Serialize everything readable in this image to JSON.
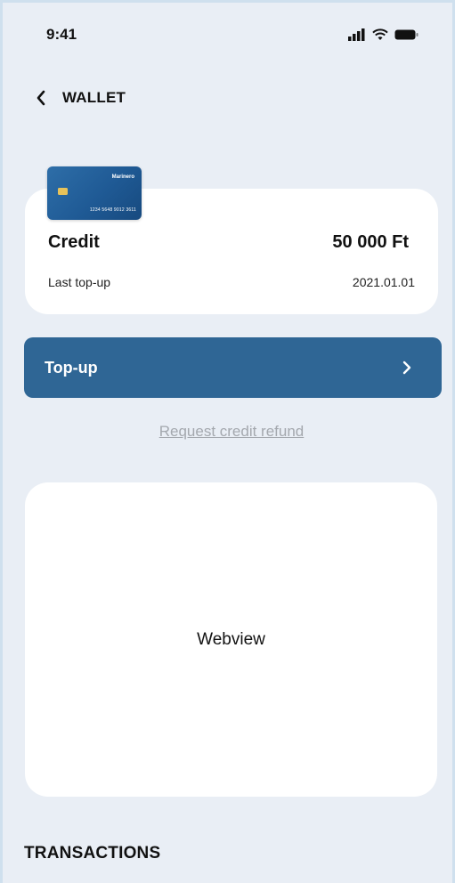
{
  "status_bar": {
    "time": "9:41"
  },
  "header": {
    "title": "WALLET"
  },
  "card": {
    "brand": "Marinero",
    "number": "1234 5648 9012 3611"
  },
  "credit": {
    "label": "Credit",
    "value": "50 000 Ft",
    "last_topup_label": "Last top-up",
    "last_topup_date": "2021.01.01"
  },
  "topup_button": {
    "label": "Top-up"
  },
  "refund_link": {
    "label": "Request credit refund"
  },
  "webview": {
    "label": "Webview"
  },
  "transactions": {
    "title": "TRANSACTIONS"
  },
  "colors": {
    "accent": "#2f6695",
    "background": "#e9eef5"
  }
}
